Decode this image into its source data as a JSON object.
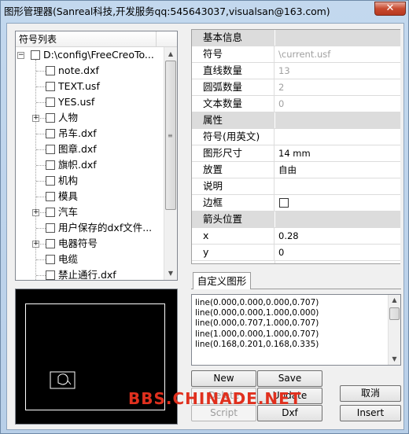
{
  "window": {
    "title": "图形管理器(Sanreal科技,开发服务qq:545643037,visualsan@163.com)",
    "close_label": "✕"
  },
  "tree": {
    "header": "符号列表",
    "root": "D:\\config\\FreeCreoTo...",
    "items": [
      {
        "label": "note.dxf",
        "expandable": false
      },
      {
        "label": "TEXT.usf",
        "expandable": false
      },
      {
        "label": "YES.usf",
        "expandable": false
      },
      {
        "label": "人物",
        "expandable": true
      },
      {
        "label": "吊车.dxf",
        "expandable": false
      },
      {
        "label": "图章.dxf",
        "expandable": false
      },
      {
        "label": "旗帜.dxf",
        "expandable": false
      },
      {
        "label": "机构",
        "expandable": false
      },
      {
        "label": "模具",
        "expandable": false
      },
      {
        "label": "汽车",
        "expandable": true
      },
      {
        "label": "用户保存的dxf文件...",
        "expandable": false
      },
      {
        "label": "电器符号",
        "expandable": true
      },
      {
        "label": "电缆",
        "expandable": false
      },
      {
        "label": "禁止通行.dxf",
        "expandable": false
      }
    ]
  },
  "properties": {
    "rows": [
      {
        "key": "基本信息",
        "value": "",
        "category": true
      },
      {
        "key": "符号",
        "value": "\\current.usf",
        "readonly": true
      },
      {
        "key": "直线数量",
        "value": "13",
        "readonly": true
      },
      {
        "key": "圆弧数量",
        "value": "2",
        "readonly": true
      },
      {
        "key": "文本数量",
        "value": "0",
        "readonly": true
      },
      {
        "key": "属性",
        "value": "",
        "category": true
      },
      {
        "key": "符号(用英文)",
        "value": ""
      },
      {
        "key": "图形尺寸",
        "value": "14 mm"
      },
      {
        "key": "放置",
        "value": "自由"
      },
      {
        "key": "说明",
        "value": ""
      },
      {
        "key": "边框",
        "value": "",
        "checkbox": true
      },
      {
        "key": "箭头位置",
        "value": "",
        "category": true
      },
      {
        "key": "x",
        "value": "0.28"
      },
      {
        "key": "y",
        "value": "0"
      }
    ]
  },
  "tab": {
    "label": "自定义图形"
  },
  "code_lines": [
    "line(0.000,0.000,0.000,0.707)",
    "line(0.000,0.000,1.000,0.000)",
    "line(0.000,0.707,1.000,0.707)",
    "line(1.000,0.000,1.000,0.707)",
    "line(0.168,0.201,0.168,0.335)"
  ],
  "buttons": {
    "new": "New",
    "save": "Save",
    "delete": "Delete",
    "update": "Update",
    "script": "Script",
    "dxf": "Dxf",
    "cancel": "取消",
    "insert": "Insert"
  },
  "watermark": "BBS.CHINADE.NET"
}
